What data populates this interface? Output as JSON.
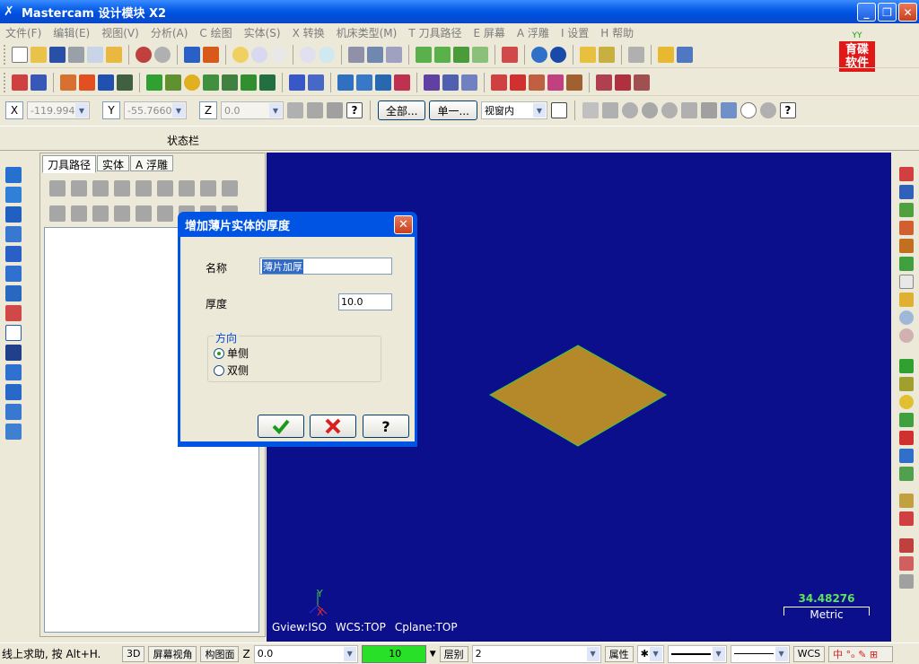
{
  "window": {
    "title": "Mastercam 设计模块  X2"
  },
  "menu": [
    "文件(F)",
    "编辑(E)",
    "视图(V)",
    "分析(A)",
    "C 绘图",
    "实体(S)",
    "X 转换",
    "机床类型(M)",
    "T 刀具路径",
    "E 屏幕",
    "A 浮雕",
    "I 设置",
    "H 帮助"
  ],
  "brand": {
    "line1": "育碟",
    "line2": "软件"
  },
  "coords": {
    "x_label": "X",
    "x_value": "-119.9947",
    "y_label": "Y",
    "y_value": "-55.76601",
    "z_label": "Z",
    "z_value": "0.0"
  },
  "selection": {
    "all_label": "全部...",
    "single_label": "单一...",
    "mode_value": "视窗内"
  },
  "status_panel": {
    "label": "状态栏"
  },
  "manager": {
    "tabs": [
      "刀具路径",
      "实体",
      "A 浮雕"
    ]
  },
  "dialog": {
    "title": "增加薄片实体的厚度",
    "name_label": "名称",
    "name_value": "薄片加厚",
    "thickness_label": "厚度",
    "thickness_value": "10.0",
    "direction_label": "方向",
    "option_single": "单侧",
    "option_double": "双侧",
    "selected_option": "单侧"
  },
  "viewport": {
    "gview": "Gview:ISO",
    "wcs": "WCS:TOP",
    "cplane": "Cplane:TOP",
    "scale_value": "34.48276",
    "scale_unit": "Metric",
    "axis_y": "Y",
    "axis_x": "X",
    "background_color": "#0c0f8c",
    "plate_color": "#b5892a"
  },
  "bottombar": {
    "help_text": "线上求助, 按 Alt+H.",
    "view3d": "3D",
    "screen_view": "屏幕视角",
    "construct_plane": "构图面",
    "z_label": "Z",
    "z_value": "0.0",
    "color_value": "10",
    "level_label": "层别",
    "level_value": "2",
    "attributes": "属性",
    "wcs": "WCS"
  }
}
